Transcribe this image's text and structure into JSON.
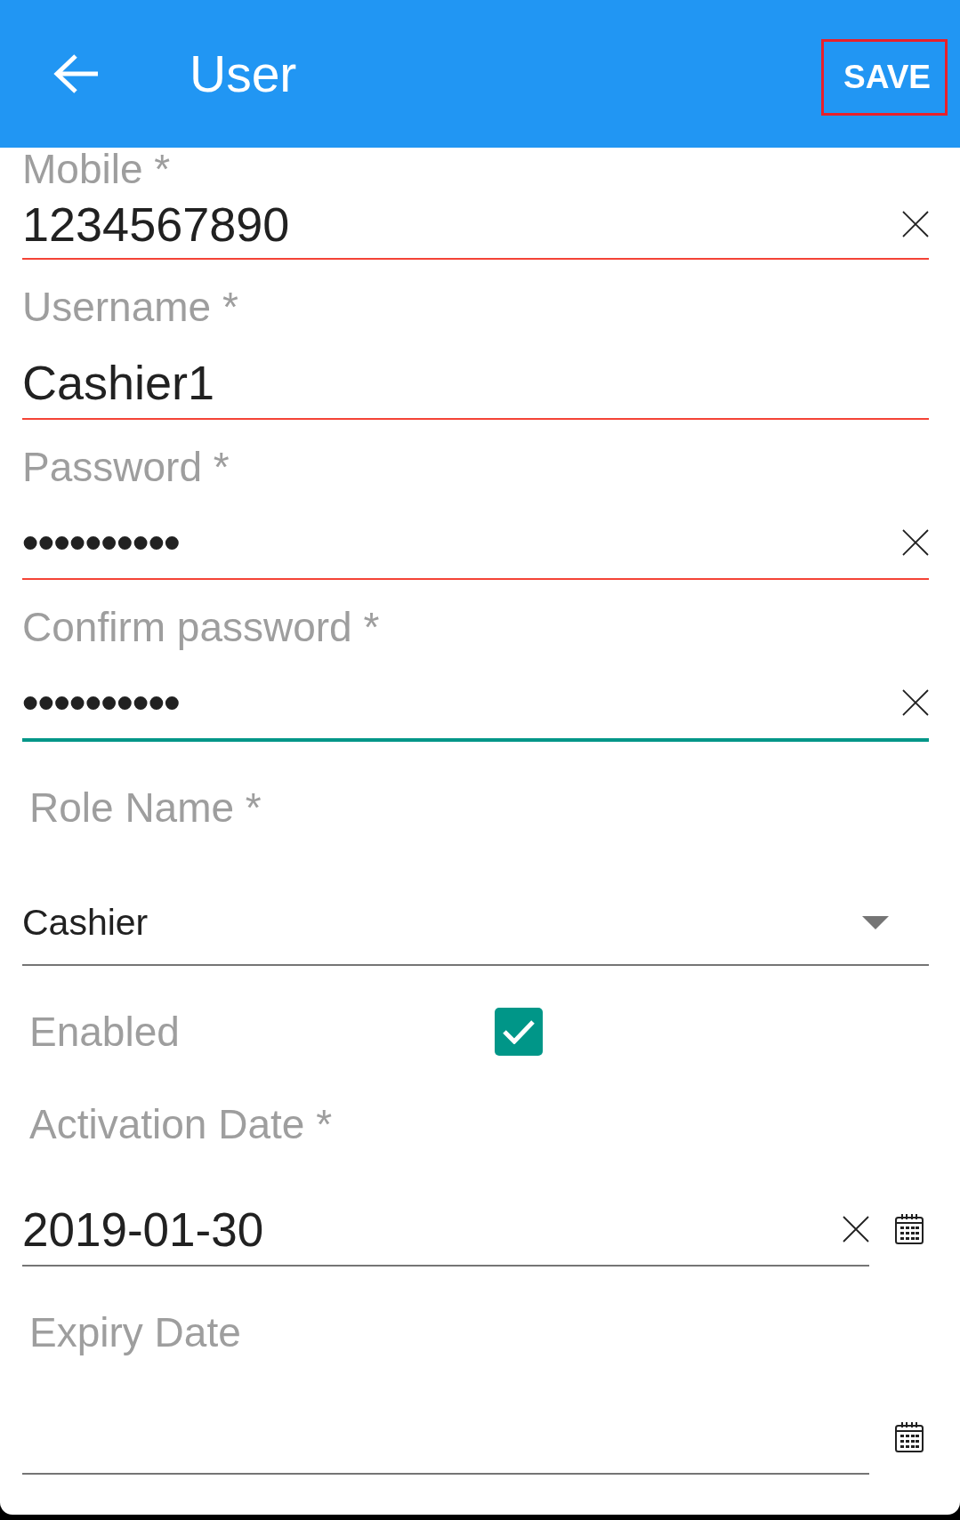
{
  "app_bar": {
    "title": "User",
    "action": {
      "label": "SAVE",
      "highlighted": true
    }
  },
  "fields": [
    {
      "kind": "text",
      "label": "Mobile *",
      "value": "1234567890",
      "clearable": true,
      "error": true,
      "focused": false
    },
    {
      "kind": "text",
      "label": "Username *",
      "value": "Cashier1",
      "clearable": false,
      "error": true,
      "focused": false
    },
    {
      "kind": "password",
      "label": "Password *",
      "value": "••••••••••",
      "clearable": true,
      "error": true,
      "focused": false
    },
    {
      "kind": "password",
      "label": "Confirm password *",
      "value": "••••••••••",
      "clearable": true,
      "error": false,
      "focused": true
    },
    {
      "kind": "select",
      "label": "Role Name *",
      "value": "Cashier",
      "error": false,
      "focused": false
    },
    {
      "kind": "checkbox",
      "label": "Enabled",
      "checked": true
    },
    {
      "kind": "date",
      "label": "Activation Date *",
      "value": "2019-01-30",
      "clearable": true,
      "error": false,
      "focused": false
    },
    {
      "kind": "date",
      "label": "Expiry Date",
      "clearable": false,
      "error": false,
      "focused": false
    }
  ]
}
